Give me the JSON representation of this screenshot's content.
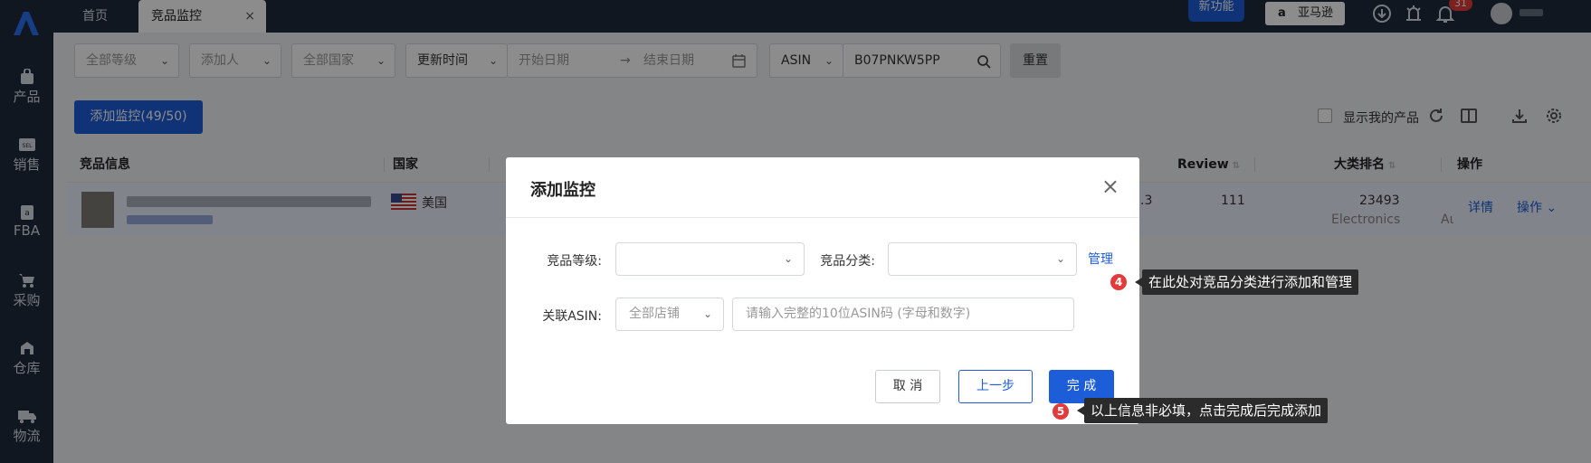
{
  "sidebar": {
    "logo_icon": "brand-logo-icon",
    "items": [
      {
        "label": "产品",
        "icon": "bag-icon"
      },
      {
        "label": "销售",
        "icon": "sell-icon"
      },
      {
        "label": "FBA",
        "icon": "amazon-box-icon"
      },
      {
        "label": "采购",
        "icon": "cart-icon"
      },
      {
        "label": "仓库",
        "icon": "warehouse-icon"
      },
      {
        "label": "物流",
        "icon": "truck-icon"
      }
    ]
  },
  "topbar": {
    "tabs": [
      {
        "label": "首页"
      },
      {
        "label": "竞品监控",
        "close": "×"
      }
    ],
    "new_feature": "新功能",
    "marketplace_button": "亚马逊",
    "notification_count": "31",
    "icons": [
      "download-icon",
      "bug-icon",
      "bell-icon"
    ]
  },
  "filters": {
    "level": "全部等级",
    "adder": "添加人",
    "country": "全部国家",
    "time_type": "更新时间",
    "start_date": "开始日期",
    "end_date": "结束日期",
    "search_type": "ASIN",
    "search_value": "B07PNKW5PP",
    "reset": "重置"
  },
  "actions": {
    "add_monitor": "添加监控(49/50)",
    "show_mine": "显示我的产品"
  },
  "table": {
    "headers": {
      "product": "竞品信息",
      "country": "国家",
      "review": "Review",
      "rank": "大类排名",
      "ops": "操作"
    },
    "row": {
      "country": "美国",
      "rating_partial": ".3",
      "review": "111",
      "rank": "23493",
      "category": "Electronics",
      "trailing": "Aι",
      "detail": "详情",
      "ops": "操作"
    }
  },
  "dialog": {
    "title": "添加监控",
    "close": "×",
    "level_label": "竞品等级:",
    "category_label": "竞品分类:",
    "manage": "管理",
    "asin_label": "关联ASIN:",
    "store_placeholder": "全部店铺",
    "asin_placeholder": "请输入完整的10位ASIN码 (字母和数字)",
    "cancel": "取 消",
    "prev": "上一步",
    "done": "完 成"
  },
  "tips": [
    {
      "step": "4",
      "text": "在此处对竞品分类进行添加和管理"
    },
    {
      "step": "5",
      "text": "以上信息非必填，点击完成后完成添加"
    }
  ],
  "colors": {
    "primary": "#1d5dd8",
    "sidebar": "#1f2b3d",
    "badge": "#e23b3b"
  }
}
